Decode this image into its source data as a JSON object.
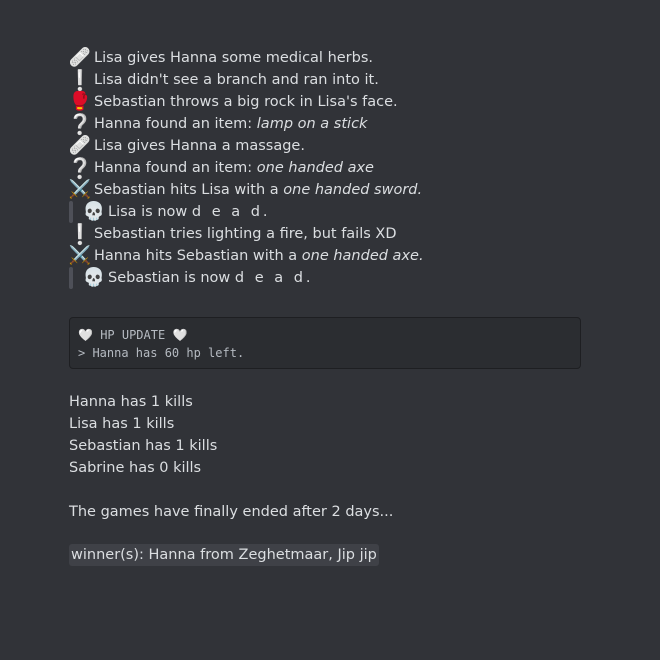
{
  "log": [
    {
      "icon": "bandage-icon",
      "glyph": "🩹",
      "segments": [
        {
          "text": "Lisa gives Hanna some medical herbs.",
          "italic": false
        }
      ]
    },
    {
      "icon": "exclamation-icon",
      "glyph": "❕",
      "segments": [
        {
          "text": "Lisa didn't see a branch and ran into it.",
          "italic": false
        }
      ]
    },
    {
      "icon": "boxing-glove-icon",
      "glyph": "🥊",
      "segments": [
        {
          "text": "Sebastian throws a big rock in Lisa's face.",
          "italic": false
        }
      ]
    },
    {
      "icon": "question-icon",
      "glyph": "❔",
      "segments": [
        {
          "text": "Hanna found an item: ",
          "italic": false
        },
        {
          "text": "lamp on a stick",
          "italic": true
        }
      ]
    },
    {
      "icon": "bandage-icon",
      "glyph": "🩹",
      "segments": [
        {
          "text": "Lisa gives Hanna a massage.",
          "italic": false
        }
      ]
    },
    {
      "icon": "question-icon",
      "glyph": "❔",
      "segments": [
        {
          "text": "Hanna found an item: ",
          "italic": false
        },
        {
          "text": "one handed axe",
          "italic": true
        }
      ]
    },
    {
      "icon": "crossed-swords-icon",
      "glyph": "⚔️",
      "segments": [
        {
          "text": "Sebastian hits Lisa with a ",
          "italic": false
        },
        {
          "text": "one handed sword.",
          "italic": true
        }
      ]
    },
    {
      "icon": "skull-icon",
      "glyph": "💀",
      "quote": true,
      "segments": [
        {
          "text": "Lisa is now ",
          "italic": false
        },
        {
          "text": "d e a d.",
          "italic": false,
          "spaced": true
        }
      ]
    },
    {
      "icon": "exclamation-icon",
      "glyph": "❕",
      "segments": [
        {
          "text": "Sebastian tries lighting a fire, but fails XD",
          "italic": false
        }
      ]
    },
    {
      "icon": "crossed-swords-icon",
      "glyph": "⚔️",
      "segments": [
        {
          "text": "Hanna hits Sebastian with a ",
          "italic": false
        },
        {
          "text": "one handed axe.",
          "italic": true
        }
      ]
    },
    {
      "icon": "skull-icon",
      "glyph": "💀",
      "quote": true,
      "segments": [
        {
          "text": "Sebastian is now ",
          "italic": false
        },
        {
          "text": "d e a d.",
          "italic": false,
          "spaced": true
        }
      ]
    }
  ],
  "hp_update": {
    "heart_glyph": "🤍",
    "title": "HP UPDATE",
    "line": "> Hanna has 60 hp left."
  },
  "kills": [
    "Hanna has 1 kills",
    "Lisa has 1 kills",
    "Sebastian has 1 kills",
    "Sabrine has 0 kills"
  ],
  "ended_text": "The games have finally ended after 2 days...",
  "winner_text": "winner(s): Hanna from Zeghetmaar, Jip jip",
  "colors": {
    "background": "#313338",
    "text": "#dbdee1",
    "code_background": "#2b2d31"
  }
}
